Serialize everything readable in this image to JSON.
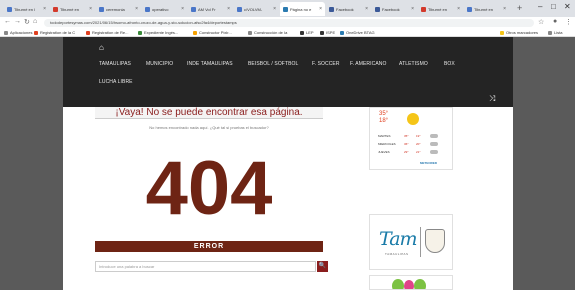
{
  "browser": {
    "tabs": [
      {
        "label": "Tiburné en l",
        "active": false,
        "fav": "#4a76c8"
      },
      {
        "label": "Tiburné en",
        "active": false,
        "fav": "#d33a2c"
      },
      {
        "label": "ceremonia",
        "active": false,
        "fav": "#4a76c8"
      },
      {
        "label": "operativo",
        "active": false,
        "fav": "#4a76c8"
      },
      {
        "label": "AM Vol Fr",
        "active": false,
        "fav": "#4a76c8"
      },
      {
        "label": "c/VOLVM-",
        "active": false,
        "fav": "#4a76c8"
      },
      {
        "label": "Página no e",
        "active": true,
        "fav": "#2a7ab0"
      },
      {
        "label": "Facebook",
        "active": false,
        "fav": "#3b5998"
      },
      {
        "label": "Facebook",
        "active": false,
        "fav": "#3b5998"
      },
      {
        "label": "Tiburné en",
        "active": false,
        "fav": "#d33a2c"
      },
      {
        "label": "Tiburné en",
        "active": false,
        "fav": "#4a76c8"
      }
    ],
    "url": "tododeportesymas.com/2021/06/15/hsomo-afronto-cruzo-de-agua-y-sto-solucion-afsc2fa4/deportestamps",
    "bookmarks": [
      {
        "label": "Aplicaciones",
        "fav": "#888888"
      },
      {
        "label": "Registration de la C",
        "fav": "#e04020"
      },
      {
        "label": "Registration de Re...",
        "fav": "#e04020"
      },
      {
        "label": "Expediente Ingés...",
        "fav": "#3a8a3a"
      },
      {
        "label": "Constructor Pixlr...",
        "fav": "#f5a000"
      },
      {
        "label": "Construcción de Ia",
        "fav": "#888888"
      },
      {
        "label": "LEP",
        "fav": "#333333"
      },
      {
        "label": "ISPE",
        "fav": "#333333"
      },
      {
        "label": "OneDrive BTAG",
        "fav": "#2a7ab0"
      }
    ],
    "bookmarks_right": [
      {
        "label": "Otros marcadores",
        "fav": "#f5c518"
      },
      {
        "label": "Lista",
        "fav": "#888888"
      }
    ]
  },
  "nav": {
    "items": [
      "TAMAULIPAS",
      "MUNICIPIO",
      "INDE TAMAULIPAS",
      "BEISBOL / SOFTBOL",
      "F. SOCCER",
      "F. AMERICANO",
      "ATLETISMO",
      "BOX"
    ],
    "items_row2": [
      "LUCHA LIBRE"
    ]
  },
  "error_page": {
    "headline": "¡Vaya! No se puede encontrar esa página.",
    "subtitle": "No hemos encontrado nada aquí. ¿Qué tal si pruebas el buscador?",
    "code": "404",
    "error_label": "ERROR",
    "search_placeholder": "Introduce una palabra a buscar"
  },
  "weather": {
    "temp_high": "35°",
    "temp_low": "18°",
    "rows": [
      {
        "day": "MARTES",
        "hi": "35°",
        "lo": "19°"
      },
      {
        "day": "MIERCOLES",
        "hi": "36°",
        "lo": "20°"
      },
      {
        "day": "JUEVES",
        "hi": "29°",
        "lo": "21°"
      }
    ],
    "footer": "METEORED"
  },
  "logo": {
    "brand": "Tam",
    "tagline": "TAMAULIPAS"
  },
  "colors": {
    "accent": "#6e2414",
    "nav_bg": "#242424",
    "side_bg": "#5a5a5a"
  }
}
